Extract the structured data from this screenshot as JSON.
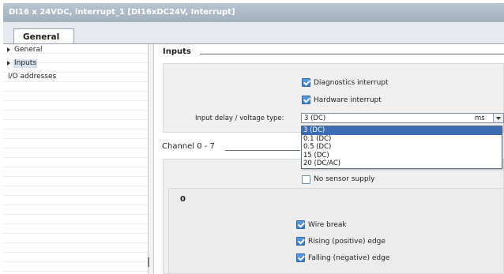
{
  "window": {
    "title": "DI16 x 24VDC, interrupt_1 [DI16xDC24V, Interrupt]"
  },
  "tabs": [
    {
      "label": "General",
      "active": true
    }
  ],
  "nav": {
    "items": [
      {
        "label": "General",
        "has_arrow": true
      },
      {
        "label": "Inputs",
        "has_arrow": true,
        "selected": true
      },
      {
        "label": "I/O addresses",
        "has_arrow": false
      }
    ]
  },
  "inputs": {
    "title": "Inputs",
    "diagnostics_interrupt": {
      "label": "Diagnostics interrupt",
      "checked": true
    },
    "hardware_interrupt": {
      "label": "Hardware interrupt",
      "checked": true
    },
    "input_delay": {
      "label": "Input delay / voltage type:",
      "value": "3 (DC)",
      "unit": "ms",
      "options": [
        "3 (DC)",
        "0.1 (DC)",
        "0.5 (DC)",
        "15 (DC)",
        "20 (DC/AC)"
      ],
      "selected_index": 0
    }
  },
  "channel": {
    "title": "Channel 0 - 7",
    "no_sensor_supply": {
      "label": "No sensor supply",
      "checked": false
    },
    "group_label": "0",
    "wire_break": {
      "label": "Wire break",
      "checked": true
    },
    "rising_edge": {
      "label": "Rising (positive) edge",
      "checked": true
    },
    "falling_edge": {
      "label": "Falling (negative) edge",
      "checked": true
    }
  }
}
